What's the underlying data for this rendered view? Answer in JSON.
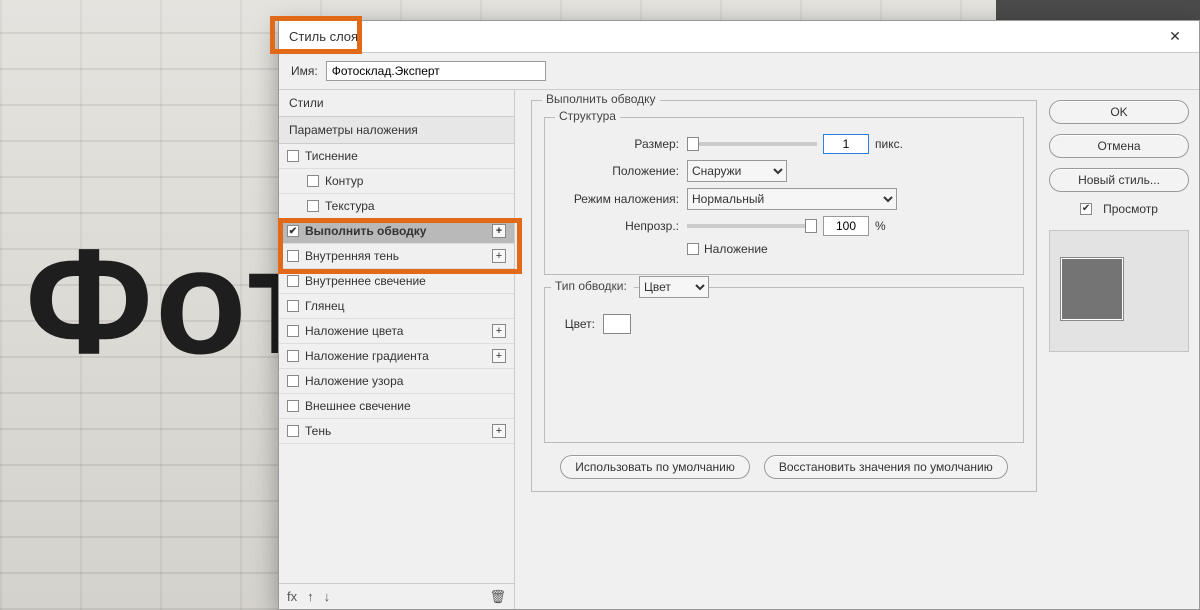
{
  "window": {
    "title": "Стиль слоя",
    "close_title": "Закрыть"
  },
  "name_row": {
    "label": "Имя:",
    "value": "Фотосклад.Эксперт"
  },
  "styles_col": {
    "header": "Стили",
    "blend_header": "Параметры наложения",
    "footer_fx": "fx"
  },
  "styles": [
    {
      "key": "emboss",
      "label": "Тиснение",
      "checked": false,
      "plus": false,
      "indent": false
    },
    {
      "key": "contour",
      "label": "Контур",
      "checked": false,
      "plus": false,
      "indent": true
    },
    {
      "key": "texture",
      "label": "Текстура",
      "checked": false,
      "plus": false,
      "indent": true
    },
    {
      "key": "stroke",
      "label": "Выполнить обводку",
      "checked": true,
      "plus": true,
      "indent": false,
      "selected": true
    },
    {
      "key": "inner-shadow",
      "label": "Внутренняя тень",
      "checked": false,
      "plus": true,
      "indent": false
    },
    {
      "key": "inner-glow",
      "label": "Внутреннее свечение",
      "checked": false,
      "plus": false,
      "indent": false
    },
    {
      "key": "satin",
      "label": "Глянец",
      "checked": false,
      "plus": false,
      "indent": false
    },
    {
      "key": "color-overlay",
      "label": "Наложение цвета",
      "checked": false,
      "plus": true,
      "indent": false
    },
    {
      "key": "gradient-overlay",
      "label": "Наложение градиента",
      "checked": false,
      "plus": true,
      "indent": false
    },
    {
      "key": "pattern-overlay",
      "label": "Наложение узора",
      "checked": false,
      "plus": false,
      "indent": false
    },
    {
      "key": "outer-glow",
      "label": "Внешнее свечение",
      "checked": false,
      "plus": false,
      "indent": false
    },
    {
      "key": "drop-shadow",
      "label": "Тень",
      "checked": false,
      "plus": true,
      "indent": false
    }
  ],
  "panel": {
    "title": "Выполнить обводку",
    "structure_title": "Структура",
    "size_label": "Размер:",
    "size_value": "1",
    "size_unit": "пикс.",
    "position_label": "Положение:",
    "position_value": "Снаружи",
    "blend_label": "Режим наложения:",
    "blend_value": "Нормальный",
    "opacity_label": "Непрозр.:",
    "opacity_value": "100",
    "opacity_unit": "%",
    "overprint_label": "Наложение",
    "filltype_label": "Тип обводки:",
    "filltype_value": "Цвет",
    "color_label": "Цвет:",
    "btn_default": "Использовать по умолчанию",
    "btn_reset": "Восстановить значения по умолчанию"
  },
  "right": {
    "ok": "OK",
    "cancel": "Отмена",
    "new_style": "Новый стиль...",
    "preview_label": "Просмотр"
  },
  "background_text": "Фото"
}
